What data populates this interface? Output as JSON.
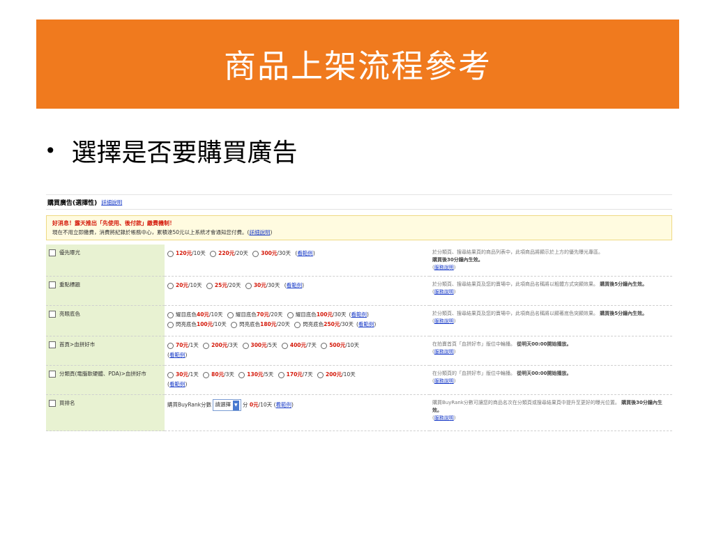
{
  "slide": {
    "title": "商品上架流程參考",
    "bullet": "選擇是否要購買廣告"
  },
  "colors": {
    "title_band": "#f07a1e",
    "price": "#d4190a",
    "name_cell": "#e8f2d2",
    "notice_bg": "#fffbe0",
    "link": "#1a3cc8"
  },
  "icons": {
    "bullet": "bullet-dot-icon",
    "checkbox": "checkbox-icon",
    "radio": "radio-icon",
    "dropdown": "chevron-down-icon"
  },
  "shot": {
    "title": "購買廣告(選擇性)",
    "detail_link": "詳細說明",
    "notice": {
      "headline": "好消息！露天推出「先使用、後付款」繳費機制！",
      "body": "現在不用立即繳費，消費將紀錄於帳務中心，累積達50元以上系統才會通知您付費。(",
      "link": "詳細說明",
      "body_end": ")"
    },
    "rows": [
      {
        "name": "優先曝光",
        "options": [
          {
            "price": "120元",
            "unit": "/10天"
          },
          {
            "price": "220元",
            "unit": "/20天"
          },
          {
            "price": "300元",
            "unit": "/30天"
          }
        ],
        "example": "看範例",
        "desc": "於分類頁、搜尋結果頁的商品列表中，此項商品將顯示於上方的優先曝光專區。",
        "desc_bold": "購買後30分鐘內生效。",
        "service": "服務說明"
      },
      {
        "name": "重點標題",
        "options": [
          {
            "price": "20元",
            "unit": "/10天"
          },
          {
            "price": "25元",
            "unit": "/20天"
          },
          {
            "price": "30元",
            "unit": "/30天"
          }
        ],
        "example": "看範例",
        "desc": "於分類頁、搜尋結果頁及您的賣場中，此項商品名稱將以粗體方式突顯效果。",
        "desc_bold": "購買後5分鐘內生效。",
        "service": "服務說明"
      },
      {
        "name": "亮眼底色",
        "options_a": [
          {
            "prefix": "耀目底色",
            "price": "40元",
            "unit": "/10天"
          },
          {
            "prefix": "耀目底色",
            "price": "70元",
            "unit": "/20天"
          },
          {
            "prefix": "耀目底色",
            "price": "100元",
            "unit": "/30天"
          }
        ],
        "options_b": [
          {
            "prefix": "閃亮底色",
            "price": "100元",
            "unit": "/10天"
          },
          {
            "prefix": "閃亮底色",
            "price": "180元",
            "unit": "/20天"
          },
          {
            "prefix": "閃亮底色",
            "price": "250元",
            "unit": "/30天"
          }
        ],
        "example": "看範例",
        "desc": "於分類頁、搜尋結果頁及您的賣場中，此項商品名稱將以顯著底色突顯效果。",
        "desc_bold": "購買後5分鐘內生效。",
        "service": "服務說明"
      },
      {
        "name": "首頁>血拼好市",
        "options": [
          {
            "price": "70元",
            "unit": "/1天"
          },
          {
            "price": "200元",
            "unit": "/3天"
          },
          {
            "price": "300元",
            "unit": "/5天"
          },
          {
            "price": "400元",
            "unit": "/7天"
          },
          {
            "price": "500元",
            "unit": "/10天"
          }
        ],
        "example": "看範例",
        "desc": "在拍賣首頁「血拼好市」版位中輪播。",
        "desc_bold": "從明天00:00開始播放。",
        "service": "服務說明"
      },
      {
        "name": "分類頁(電腦軟硬體、PDA)>血拼好市",
        "options": [
          {
            "price": "30元",
            "unit": "/1天"
          },
          {
            "price": "80元",
            "unit": "/3天"
          },
          {
            "price": "130元",
            "unit": "/5天"
          },
          {
            "price": "170元",
            "unit": "/7天"
          },
          {
            "price": "200元",
            "unit": "/10天"
          }
        ],
        "example": "看範例",
        "desc": "在分類頁的「血拼好市」版位中輪播。",
        "desc_bold": "從明天00:00開始播放。",
        "service": "服務說明"
      },
      {
        "name": "買排名",
        "buy_label": "購買BuyRank分數",
        "select_value": "請選擇",
        "after_select": "分",
        "price": "0元",
        "unit": "/10天",
        "example": "看範例",
        "desc": "購買BuyRank分數可讓您的商品名次在分類頁或搜尋結果頁中提升至更好的曝光位置。",
        "desc_bold": "購買後30分鐘內生效。",
        "service": "服務說明"
      }
    ]
  }
}
